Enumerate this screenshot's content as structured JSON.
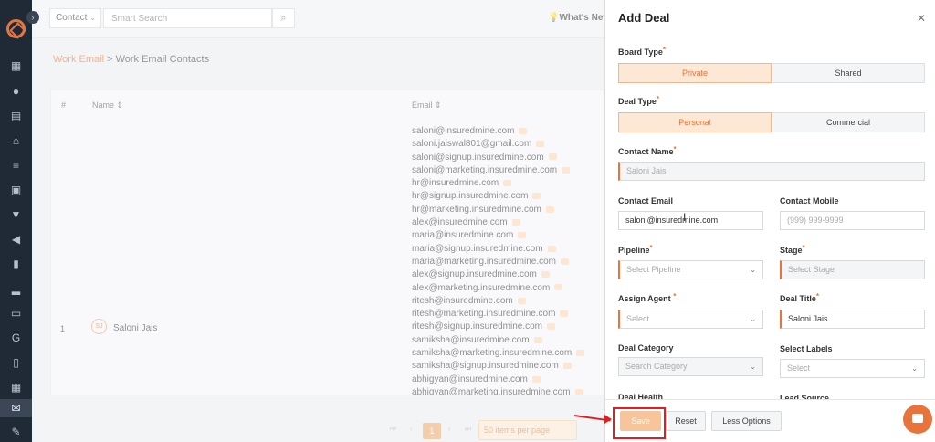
{
  "topbar": {
    "contact_label": "Contact",
    "search_placeholder": "Smart Search",
    "whats_new": "What's New"
  },
  "breadcrumb": {
    "parent": "Work Email",
    "separator": " > ",
    "current": "Work Email Contacts"
  },
  "table": {
    "headers": {
      "num": "#",
      "name": "Name",
      "email": "Email"
    },
    "row": {
      "num": "1",
      "initials": "SJ",
      "name": "Saloni Jais",
      "emails": [
        "saloni@insuredmine.com",
        "saloni.jaiswal801@gmail.com",
        "saloni@signup.insuredmine.com",
        "saloni@marketing.insuredmine.com",
        "hr@insuredmine.com",
        "hr@signup.insuredmine.com",
        "hr@marketing.insuredmine.com",
        "alex@insuredmine.com",
        "maria@insuredmine.com",
        "maria@signup.insuredmine.com",
        "maria@marketing.insuredmine.com",
        "alex@signup.insuredmine.com",
        "alex@marketing.insuredmine.com",
        "ritesh@insuredmine.com",
        "ritesh@marketing.insuredmine.com",
        "ritesh@signup.insuredmine.com",
        "samiksha@insuredmine.com",
        "samiksha@marketing.insuredmine.com",
        "samiksha@signup.insuredmine.com",
        "abhigyan@insuredmine.com",
        "abhigyan@marketing.insuredmine.com"
      ]
    }
  },
  "pagination": {
    "current": "1",
    "items_per_page": "50 items per page"
  },
  "panel": {
    "title": "Add Deal",
    "board_type": {
      "label": "Board Type",
      "options": [
        "Private",
        "Shared"
      ],
      "selected": "Private"
    },
    "deal_type": {
      "label": "Deal Type",
      "options": [
        "Personal",
        "Commercial"
      ],
      "selected": "Personal"
    },
    "contact_name": {
      "label": "Contact Name",
      "value": "Saloni Jais"
    },
    "contact_email": {
      "label": "Contact Email",
      "value": "saloni@insuredmine.com"
    },
    "contact_mobile": {
      "label": "Contact Mobile",
      "placeholder": "(999) 999-9999"
    },
    "pipeline": {
      "label": "Pipeline",
      "placeholder": "Select Pipeline"
    },
    "stage": {
      "label": "Stage",
      "placeholder": "Select Stage"
    },
    "assign_agent": {
      "label": "Assign Agent",
      "placeholder": "Select"
    },
    "deal_title": {
      "label": "Deal Title",
      "value": "Saloni Jais"
    },
    "deal_category": {
      "label": "Deal Category",
      "placeholder": "Search Category"
    },
    "select_labels": {
      "label": "Select Labels",
      "placeholder": "Select"
    },
    "deal_health": {
      "label": "Deal Health"
    },
    "lead_source": {
      "label": "Lead Source"
    },
    "buttons": {
      "save": "Save",
      "reset": "Reset",
      "less": "Less Options"
    }
  },
  "colors": {
    "accent": "#e8743b",
    "sidebar": "#1f2a36",
    "highlight": "#e02020"
  }
}
